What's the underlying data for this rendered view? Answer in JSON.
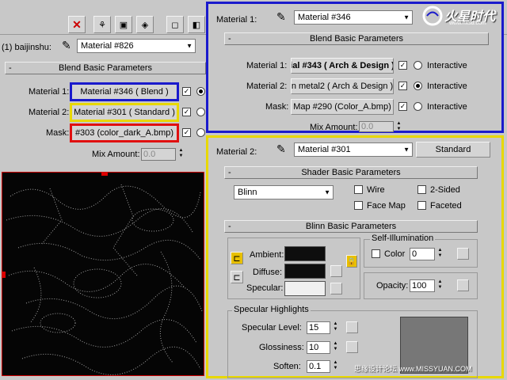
{
  "toolbar": {
    "icons": [
      "delete-icon",
      "material-icon",
      "map-icon",
      "show-map-icon",
      "go-parent-icon"
    ]
  },
  "left_panel": {
    "object_label": "(1) baijinshu:",
    "material_dropdown": "Material #826",
    "rollout_title": "Blend Basic Parameters",
    "material1_label": "Material 1:",
    "material1_button": "Material #346  ( Blend )",
    "material2_label": "Material 2:",
    "material2_button": "Material #301  ( Standard )",
    "mask_label": "Mask:",
    "mask_button": "#303 (color_dark_A.bmp)",
    "mix_amount_label": "Mix Amount:",
    "mix_amount_value": "0.0"
  },
  "blend_panel": {
    "material_label": "Material 1:",
    "material_dropdown": "Material #346",
    "rollout_title": "Blend Basic Parameters",
    "material1_label": "Material 1:",
    "material1_button": "ial #343  ( Arch & Design )",
    "material2_label": "Material 2:",
    "material2_button": "n metal2  ( Arch & Design )",
    "mask_label": "Mask:",
    "mask_button": "Map #290 (Color_A.bmp)",
    "interactive_label": "Interactive",
    "mix_amount_label": "Mix Amount:",
    "mix_amount_value": "0.0"
  },
  "standard_panel": {
    "material_label": "Material 2:",
    "material_dropdown": "Material #301",
    "type_button": "Standard",
    "shader_rollout": "Shader Basic Parameters",
    "shader_value": "Blinn",
    "wire_label": "Wire",
    "two_sided_label": "2-Sided",
    "face_map_label": "Face Map",
    "faceted_label": "Faceted",
    "blinn_rollout": "Blinn Basic Parameters",
    "self_illum_title": "Self-Illumination",
    "color_label": "Color",
    "color_value": "0",
    "ambient_label": "Ambient:",
    "diffuse_label": "Diffuse:",
    "specular_label": "Specular:",
    "opacity_label": "Opacity:",
    "opacity_value": "100",
    "spec_highlights_title": "Specular Highlights",
    "spec_level_label": "Specular Level:",
    "spec_level_value": "15",
    "glossiness_label": "Glossiness:",
    "glossiness_value": "10",
    "soften_label": "Soften:",
    "soften_value": "0.1"
  },
  "watermark": {
    "logo_text": "火星时代",
    "logo_sub": "www.hxsd.com",
    "footer_text": "思缘设计论坛  www.MISSYUAN.COM"
  },
  "colors": {
    "blue_frame": "#1a1acc",
    "yellow_frame": "#e8d800",
    "red_frame": "#e01010",
    "ambient": "#0e0e0e",
    "diffuse": "#0e0e0e",
    "specular": "#f0f0f0"
  }
}
